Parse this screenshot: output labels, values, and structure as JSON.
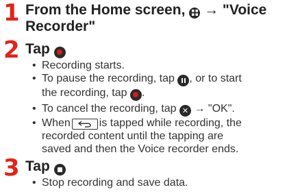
{
  "colors": {
    "step_number": "#e2231a",
    "icon_dark": "#2a2a2a",
    "record_red": "#d41c1c"
  },
  "steps": [
    {
      "number": "1",
      "title_before": "From the Home screen,",
      "title_icon": "apps-grid-icon",
      "title_after": "→ \"Voice",
      "title_line2": "Recorder\""
    },
    {
      "number": "2",
      "title": "Tap",
      "title_icon": "record-icon",
      "bullets": {
        "starts": "Recording starts.",
        "pause_before": "To pause the recording, tap",
        "pause_icon": "pause-icon",
        "pause_middle": ", or to start",
        "pause_line2_before": "the recording, tap",
        "pause_line2_icon": "record-icon",
        "pause_line2_after": ".",
        "cancel_before": "To cancel the recording, tap",
        "cancel_icon": "cancel-icon",
        "cancel_after": "→ \"OK\".",
        "back_before": "When",
        "back_icon": "back-key-icon",
        "back_after": "is tapped while recording, the",
        "back_line2": "recorded content until the tapping are",
        "back_line3": "saved and then the Voice recorder ends."
      }
    },
    {
      "number": "3",
      "title": "Tap",
      "title_icon": "stop-icon",
      "bullets": {
        "stop": "Stop recording and save data."
      }
    }
  ]
}
